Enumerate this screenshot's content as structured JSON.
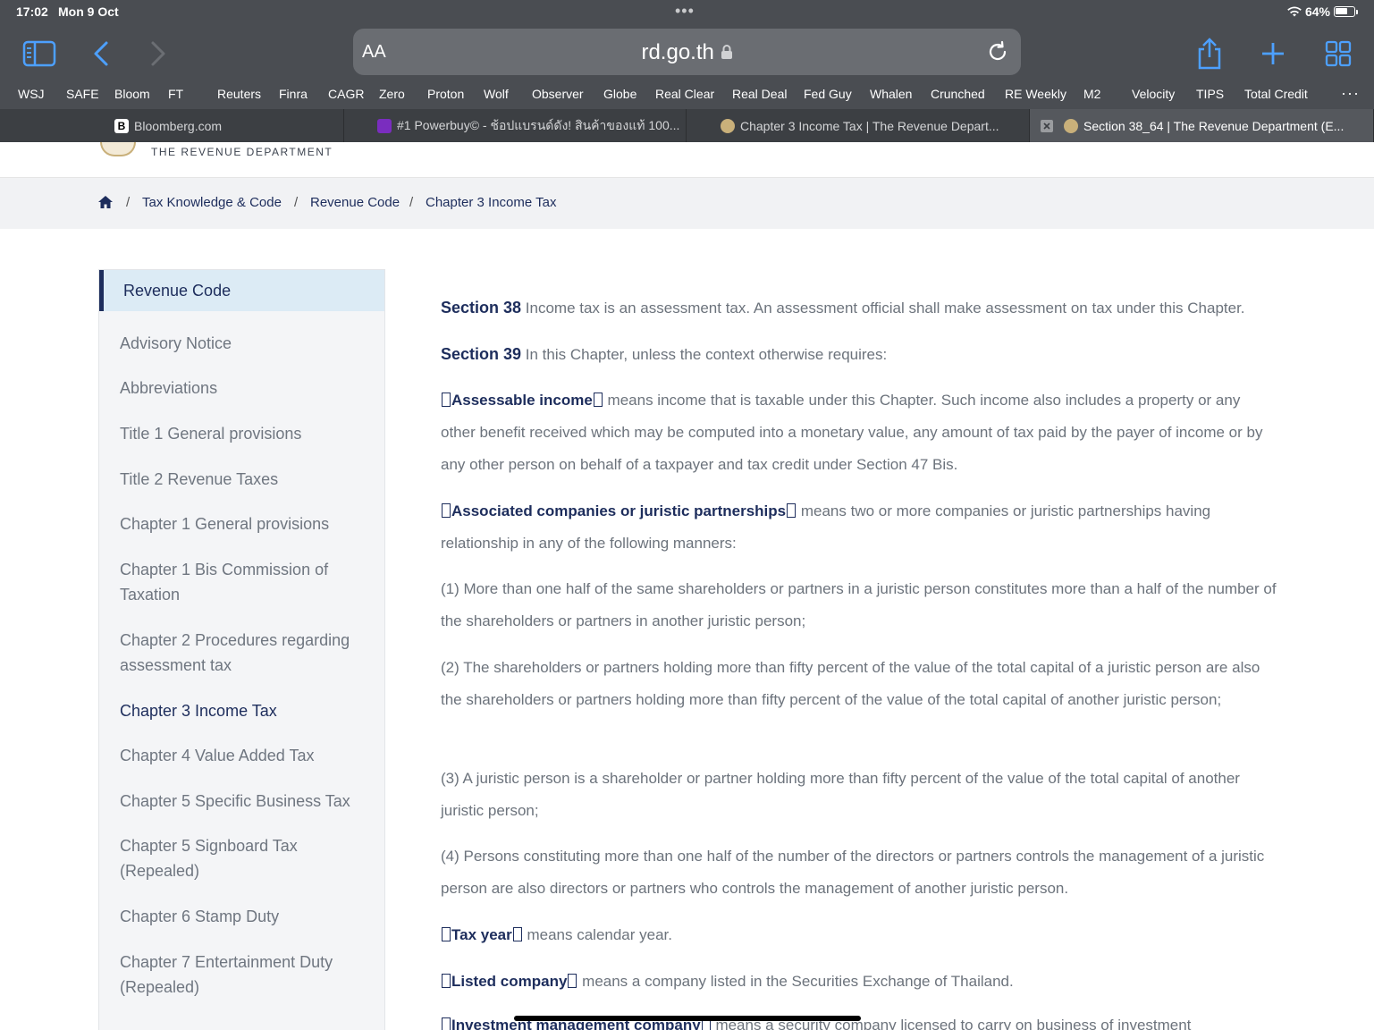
{
  "status": {
    "time": "17:02",
    "date": "Mon 9 Oct",
    "battery": "64%"
  },
  "browser": {
    "url": "rd.go.th",
    "aa_label": "AA",
    "bookmarks": [
      "WSJ",
      "SAFE",
      "Bloom",
      "FT",
      "Reuters",
      "Finra",
      "CAGR",
      "Zero",
      "Proton",
      "Wolf",
      "Observer",
      "Globe",
      "Real Clear",
      "Real Deal",
      "Fed Guy",
      "Whalen",
      "Crunched",
      "RE Weekly",
      "M2",
      "Velocity",
      "TIPS",
      "Total Credit"
    ],
    "tabs": [
      {
        "title": "Bloomberg.com"
      },
      {
        "title": "#1 Powerbuy© - ช้อปแบรนด์ดัง! สินค้าของแท้ 100..."
      },
      {
        "title": "Chapter 3 Income Tax | The Revenue Depart..."
      },
      {
        "title": "Section 38_64 | The Revenue Department (E..."
      }
    ]
  },
  "site": {
    "dept_name": "THE REVENUE DEPARTMENT"
  },
  "breadcrumb": [
    "Tax Knowledge & Code",
    "Revenue Code",
    "Chapter 3 Income Tax"
  ],
  "sidebar": {
    "heading": "Revenue Code",
    "items": [
      "Advisory Notice",
      "Abbreviations",
      "Title 1 General provisions",
      "Title 2 Revenue Taxes",
      "Chapter 1 General provisions",
      "Chapter 1 Bis Commission of Taxation",
      "Chapter 2 Procedures regarding assessment tax",
      "Chapter 3 Income Tax",
      "Chapter 4 Value Added Tax",
      "Chapter 5 Specific Business Tax",
      "Chapter 5 Signboard Tax (Repealed)",
      "Chapter 6 Stamp Duty",
      "Chapter 7 Entertainment Duty (Repealed)"
    ]
  },
  "content": {
    "s38_label": "Section 38",
    "s38_text": "Income tax is an assessment tax. An assessment official shall make assessment on tax under this Chapter.",
    "s39_label": "Section 39",
    "s39_text": "In this Chapter, unless the context otherwise requires:",
    "d1_term": "Assessable income",
    "d1_text": "means income that is taxable under this Chapter. Such income also includes a property or any other benefit received which may be computed into a monetary value, any amount of tax paid by the payer of income or by any other person on behalf of a taxpayer and tax credit under Section 47 Bis.",
    "d2_term": "Associated companies or juristic partnerships",
    "d2_text": "means two or more companies or juristic partnerships having relationship in any of the following manners:",
    "i1": "(1) More than one half of the same shareholders or partners in a juristic person constitutes more than a half of the number of the shareholders or partners in another juristic person;",
    "i2": "(2) The shareholders or partners holding more than fifty percent of the value of the total capital of a juristic person are also the shareholders or partners holding more than fifty percent of the value of the total capital of another juristic person;",
    "i3": "(3) A juristic person is a shareholder or partner holding more than fifty percent of the value of the total capital of another juristic person;",
    "i4": "(4) Persons constituting more than one half of the number of the directors or partners controls the management of a juristic person are also directors or partners who controls the management of another juristic person.",
    "d3_term": "Tax year",
    "d3_text": "means calendar year.",
    "d4_term": "Listed company",
    "d4_text": "means a company listed in the Securities Exchange of Thailand.",
    "d5_term": "Investment management company",
    "d5_text": "means a security company licensed to carry on business of investment"
  }
}
